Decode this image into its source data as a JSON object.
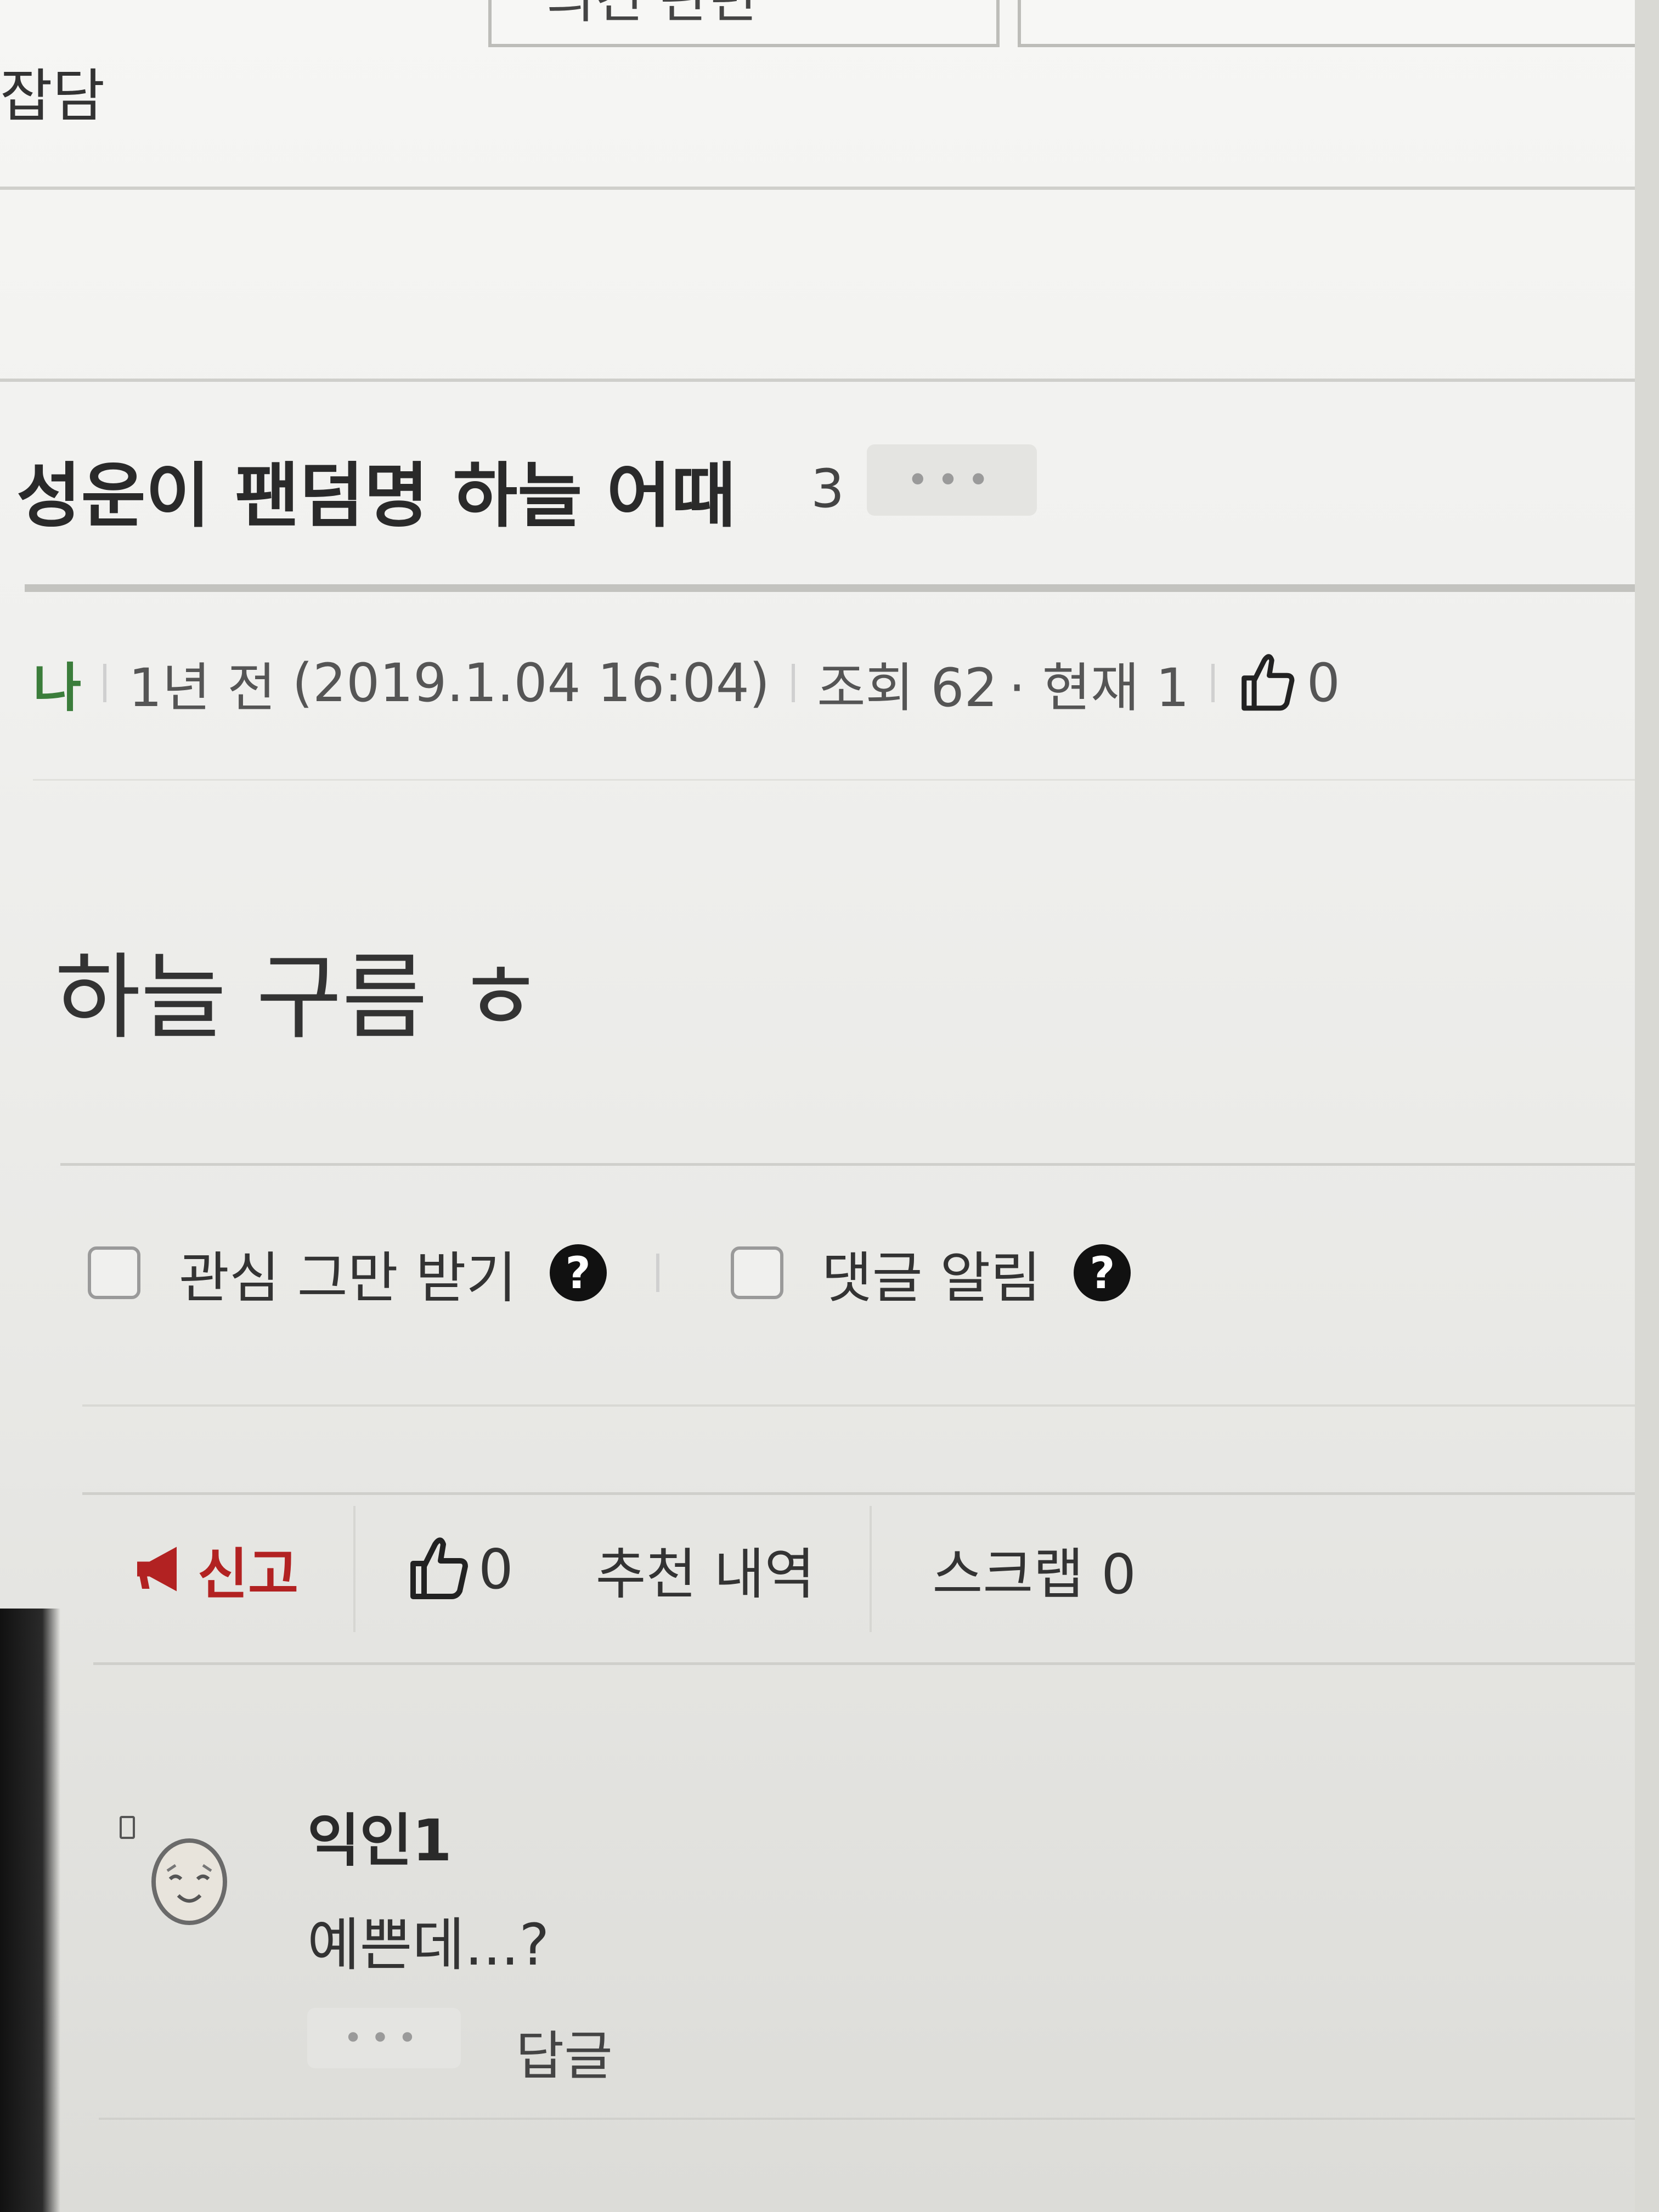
{
  "top_nav": {
    "tabs": [
      {
        "label": "의견 관련"
      },
      {
        "label": ""
      }
    ]
  },
  "board": {
    "name": "잡담"
  },
  "post": {
    "title": "성운이 팬덤명 하늘 어때",
    "comment_count": "3",
    "more_label": "•••",
    "author": "나",
    "time_ago": "1년 전",
    "datetime": "(2019.1.04 16:04)",
    "views_label": "조회 62",
    "current_label": "· 현재 1",
    "likes": "0",
    "content": "하늘 구름 ㅎ"
  },
  "options": {
    "stop_interest_label": "관심 그만 받기",
    "comment_alert_label": "댓글 알림",
    "help_glyph": "?"
  },
  "actions": {
    "report_label": "신고",
    "like_count": "0",
    "recommend_history_label": "추천 내역",
    "scrap_label": "스크랩 0"
  },
  "comments": [
    {
      "author": "익인1",
      "body": "예쁜데...?",
      "more_label": "•••",
      "reply_label": "답글"
    }
  ],
  "colors": {
    "author_green": "#3b7d3b",
    "report_red": "#b22222"
  },
  "icons": [
    "thumbs-up-icon",
    "megaphone-icon",
    "question-circle-icon",
    "avatar-egg-icon",
    "more-dots-icon"
  ]
}
